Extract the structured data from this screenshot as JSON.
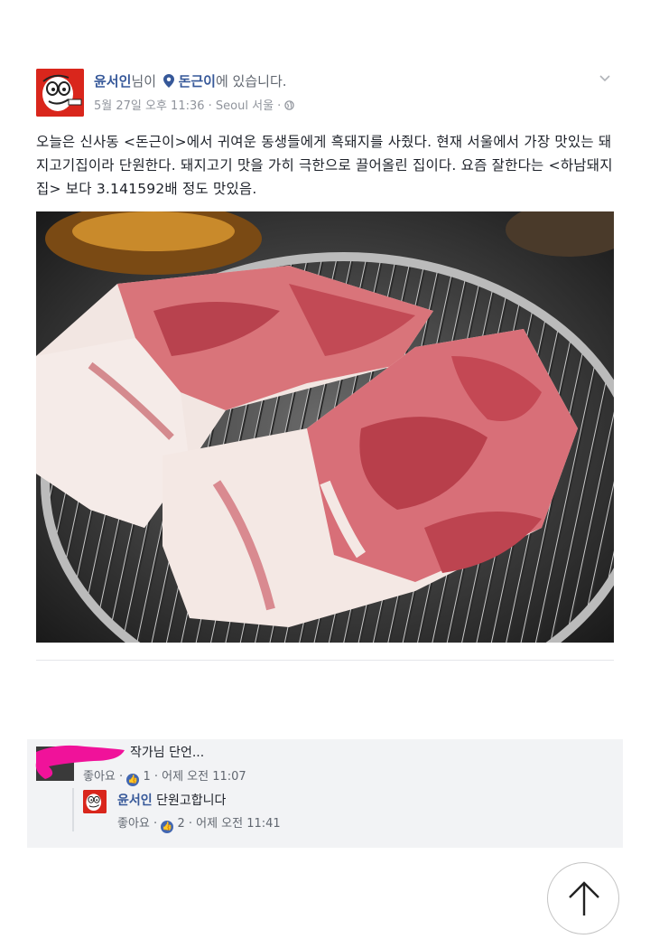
{
  "post": {
    "author": "윤서인",
    "connector": "님이",
    "place": "돈근이",
    "at_suffix": "에 있습니다.",
    "date": "5월 27일 오후 11:36",
    "location": "Seoul 서울",
    "body": "오늘은 신사동 <돈근이>에서 귀여운 동생들에게 흑돼지를 사줬다. 현재 서울에서 가장 맛있는 돼지고기집이라 단원한다. 돼지고기 맛을 가히 극한으로 끌어올린 집이다. 요즘 잘한다는 <하남돼지집> 보다 3.141592배 정도 맛있음."
  },
  "comments": [
    {
      "text": "작가님 단언...",
      "like_label": "좋아요",
      "like_count": "1",
      "time": "어제 오전 11:07"
    },
    {
      "author": "윤서인",
      "text": "단원고합니다",
      "like_label": "좋아요",
      "like_count": "2",
      "time": "어제 오전 11:41"
    }
  ],
  "colors": {
    "link": "#365899",
    "muted": "#90949c",
    "avatar_red": "#d9261c",
    "comment_bg": "#f2f3f5",
    "like_blue": "#4267b2"
  },
  "icons": {
    "place_pin": "location-pin-icon",
    "globe": "globe-icon",
    "options": "chevron-down-icon",
    "like": "thumbs-up-icon",
    "scroll_top": "arrow-up-icon"
  }
}
